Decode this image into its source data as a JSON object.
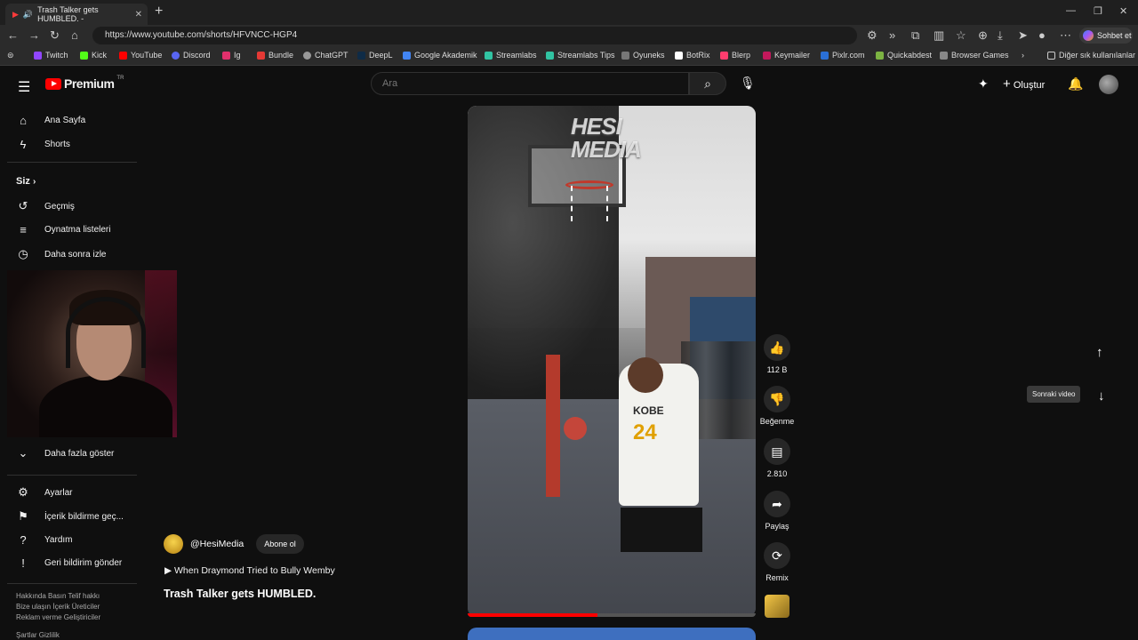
{
  "browser": {
    "tab_title": "Trash Talker gets HUMBLED. -",
    "url": "https://www.youtube.com/shorts/HFVNCC-HGP4",
    "chat_button": "Sohbet et",
    "bookmarks": [
      "Twitch",
      "Kick",
      "YouTube",
      "Discord",
      "Ig",
      "Bundle",
      "ChatGPT",
      "DeepL",
      "Google Akademik",
      "Streamlabs",
      "Streamlabs Tips",
      "Oyuneks",
      "BotRix",
      "Blerp",
      "Keymailer",
      "Pixlr.com",
      "Quickabdest",
      "Browser Games"
    ],
    "other_bookmarks": "Diğer sık kullanılanlar"
  },
  "header": {
    "logo_text": "Premium",
    "region": "TR",
    "search_placeholder": "Ara",
    "create_label": "Oluştur"
  },
  "sidebar": {
    "home": "Ana Sayfa",
    "shorts": "Shorts",
    "you": "Siz",
    "history": "Geçmiş",
    "playlists": "Oynatma listeleri",
    "watch_later": "Daha sonra izle",
    "show_more": "Daha fazla göster",
    "settings": "Ayarlar",
    "report_history": "İçerik bildirme geç...",
    "help": "Yardım",
    "feedback": "Geri bildirim gönder",
    "footer1": "Hakkında   Basın   Telif hakkı",
    "footer2": "Bize ulaşın   İçerik Üreticiler",
    "footer3": "Reklam verme   Geliştiriciler",
    "footer4": "Şartlar   Gizlilik"
  },
  "video": {
    "watermark_line1": "HESI",
    "watermark_line2": "MEDIA",
    "jersey_name": "KOBE",
    "jersey_number": "24",
    "progress_fraction": 0.45
  },
  "short_info": {
    "channel": "@HesiMedia",
    "subscribe": "Abone ol",
    "playlist": "▶ When Draymond Tried to Bully Wemby",
    "title": "Trash Talker gets HUMBLED."
  },
  "actions": {
    "likes": "112 B",
    "dislike": "Beğenme",
    "comments": "2.810",
    "share": "Paylaş",
    "remix": "Remix"
  },
  "navigation": {
    "next_tooltip": "Sonraki video"
  }
}
